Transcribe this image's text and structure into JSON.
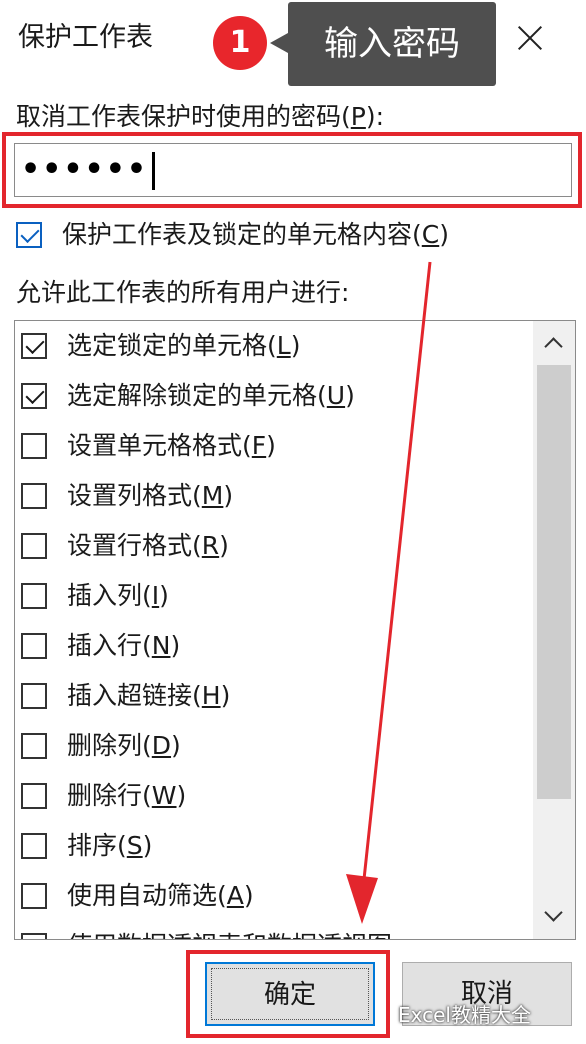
{
  "window": {
    "title": "保护工作表",
    "help_glyph": "?"
  },
  "annotation": {
    "step_number": "1",
    "callout_text": "输入密码",
    "color": "#e3262d"
  },
  "password": {
    "label_prefix": "取消工作表保护时使用的密码(",
    "label_key": "P",
    "label_suffix": "):",
    "value": "••••••"
  },
  "protect_option": {
    "label_prefix": "保护工作表及锁定的单元格内容(",
    "label_key": "C",
    "label_suffix": ")",
    "checked": true
  },
  "permissions_label": "允许此工作表的所有用户进行:",
  "permissions": [
    {
      "label": "选定锁定的单元格",
      "key": "L",
      "checked": true
    },
    {
      "label": "选定解除锁定的单元格",
      "key": "U",
      "checked": true
    },
    {
      "label": "设置单元格格式",
      "key": "F",
      "checked": false
    },
    {
      "label": "设置列格式",
      "key": "M",
      "checked": false
    },
    {
      "label": "设置行格式",
      "key": "R",
      "checked": false
    },
    {
      "label": "插入列",
      "key": "I",
      "checked": false
    },
    {
      "label": "插入行",
      "key": "N",
      "checked": false
    },
    {
      "label": "插入超链接",
      "key": "H",
      "checked": false
    },
    {
      "label": "删除列",
      "key": "D",
      "checked": false
    },
    {
      "label": "删除行",
      "key": "W",
      "checked": false
    },
    {
      "label": "排序",
      "key": "S",
      "checked": false
    },
    {
      "label": "使用自动筛选",
      "key": "A",
      "checked": false
    },
    {
      "label": "使用数据透视表和数据透视图",
      "key": "",
      "checked": false
    }
  ],
  "buttons": {
    "ok": "确定",
    "cancel": "取消"
  },
  "watermark": "Excel教精大全"
}
